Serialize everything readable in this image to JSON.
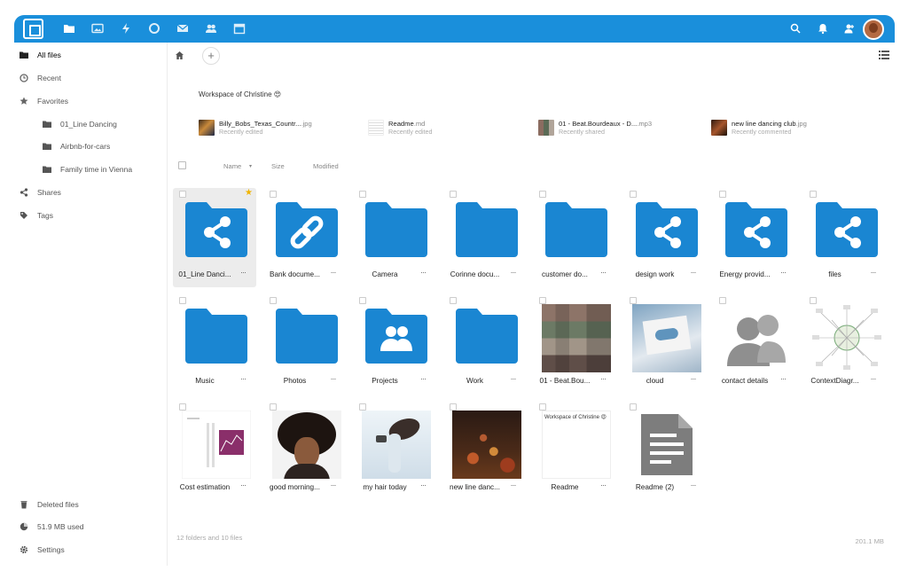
{
  "sidebar": {
    "items": [
      {
        "label": "All files",
        "icon": "folder-icon"
      },
      {
        "label": "Recent",
        "icon": "clock-icon"
      },
      {
        "label": "Favorites",
        "icon": "star-icon"
      },
      {
        "label": "01_Line Dancing",
        "icon": "folder-icon"
      },
      {
        "label": "Airbnb-for-cars",
        "icon": "folder-icon"
      },
      {
        "label": "Family time in Vienna",
        "icon": "folder-icon"
      },
      {
        "label": "Shares",
        "icon": "share-icon"
      },
      {
        "label": "Tags",
        "icon": "tag-icon"
      }
    ],
    "footer": [
      {
        "label": "Deleted files",
        "icon": "trash-icon"
      },
      {
        "label": "51.9 MB used",
        "icon": "pie-icon"
      },
      {
        "label": "Settings",
        "icon": "gear-icon"
      }
    ]
  },
  "workspace": "Workspace of Christine 😍",
  "recent": [
    {
      "name": "Billy_Bobs_Texas_Countr...",
      "ext": ".jpg",
      "status": "Recently edited"
    },
    {
      "name": "Readme",
      "ext": ".md",
      "status": "Recently edited"
    },
    {
      "name": "01 - Beat.Bourdeaux - D...",
      "ext": ".mp3",
      "status": "Recently shared"
    },
    {
      "name": "new line dancing club",
      "ext": ".jpg",
      "status": "Recently commented"
    }
  ],
  "list_header": {
    "name": "Name",
    "size": "Size",
    "modified": "Modified",
    "sort_arrow": "▾"
  },
  "files": [
    {
      "label": "01_Line Danci...",
      "type": "folder-shared"
    },
    {
      "label": "Bank docume...",
      "type": "folder-link"
    },
    {
      "label": "Camera",
      "type": "folder"
    },
    {
      "label": "Corinne docu...",
      "type": "folder"
    },
    {
      "label": "customer do...",
      "type": "folder"
    },
    {
      "label": "design work",
      "type": "folder-shared"
    },
    {
      "label": "Energy provid...",
      "type": "folder-shared"
    },
    {
      "label": "files",
      "type": "folder-shared"
    },
    {
      "label": "Music",
      "type": "folder"
    },
    {
      "label": "Photos",
      "type": "folder"
    },
    {
      "label": "Projects",
      "type": "folder-group"
    },
    {
      "label": "Work",
      "type": "folder"
    },
    {
      "label": "01 - Beat.Bou...",
      "type": "image-collage"
    },
    {
      "label": "cloud",
      "type": "image-cloud"
    },
    {
      "label": "contact details",
      "type": "contact-icon"
    },
    {
      "label": "ContextDiagr...",
      "type": "image-diagram"
    },
    {
      "label": "Cost estimation",
      "type": "image-doc"
    },
    {
      "label": "good morning...",
      "type": "image-afro"
    },
    {
      "label": "my hair today",
      "type": "image-hair"
    },
    {
      "label": "new line danc...",
      "type": "image-dance"
    },
    {
      "label": "Readme",
      "type": "text-preview",
      "preview": "Workspace of Christine 😍"
    },
    {
      "label": "Readme (2)",
      "type": "document-icon"
    }
  ],
  "more_label": "···",
  "summary": {
    "left": "12 folders and 10 files",
    "right": "201.1 MB"
  },
  "colors": {
    "accent": "#1a8fdb",
    "folder": "#1a86d2",
    "star": "#f0b400"
  }
}
